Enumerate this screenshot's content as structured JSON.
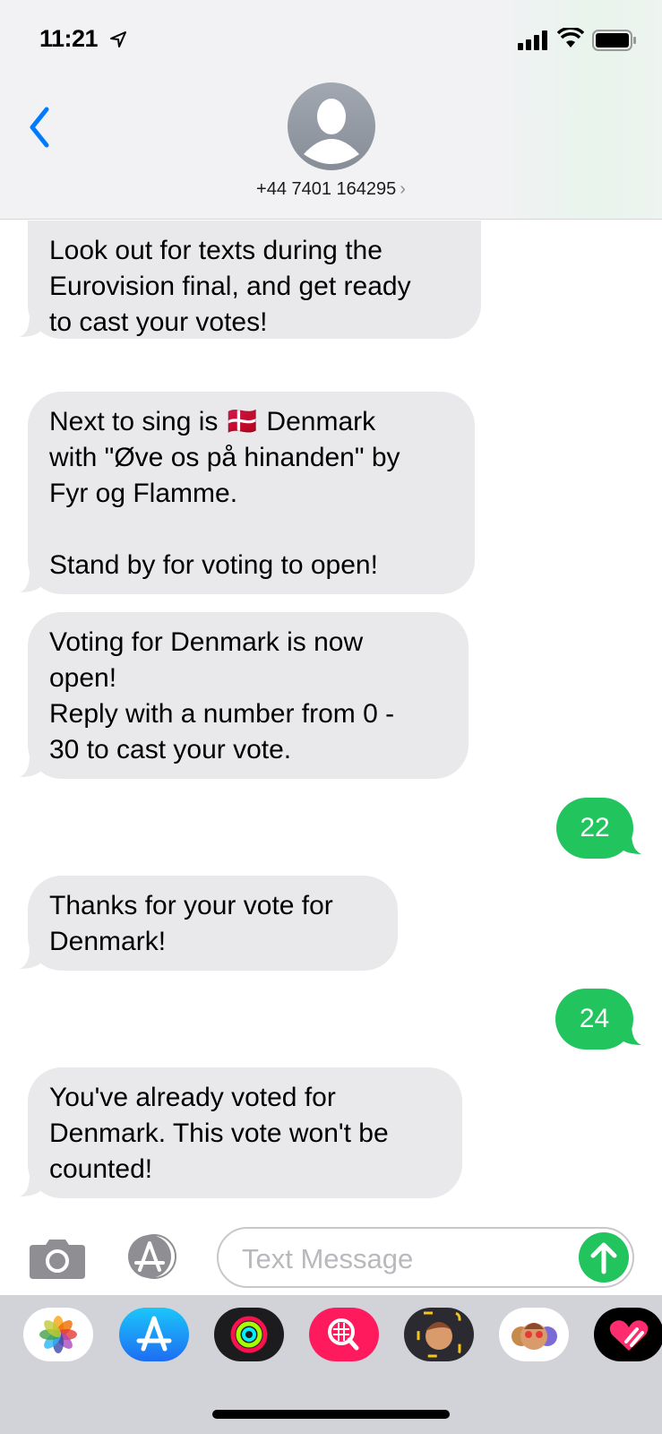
{
  "status_bar": {
    "time": "11:21",
    "icons": [
      "location-arrow-icon",
      "cellular-signal-icon",
      "wifi-icon",
      "battery-icon"
    ]
  },
  "header": {
    "back_icon": "chevron-left-icon",
    "contact": "+44 7401 164295",
    "chevron": "›",
    "avatar_icon": "person-silhouette-icon"
  },
  "messages": [
    {
      "direction": "incoming",
      "text": "Look out for texts during the\nEurovision final, and get ready\nto cast your votes!"
    },
    {
      "direction": "incoming",
      "text": "Next to sing is 🇩🇰 Denmark\nwith \"Øve os på hinanden\" by\nFyr og Flamme.\n\nStand by for voting to open!"
    },
    {
      "direction": "incoming",
      "text": "Voting for Denmark is now\nopen!\nReply with a number from 0 -\n30 to cast your vote."
    },
    {
      "direction": "outgoing",
      "text": "22"
    },
    {
      "direction": "incoming",
      "text": "Thanks for your vote for\nDenmark!"
    },
    {
      "direction": "outgoing",
      "text": "24"
    },
    {
      "direction": "incoming",
      "text": "You've already voted for\nDenmark. This vote won't be\ncounted!"
    }
  ],
  "composer": {
    "placeholder": "Text Message",
    "camera_icon": "camera-icon",
    "apps_icon": "app-store-icon",
    "send_icon": "send-arrow-up-icon"
  },
  "app_strip": [
    "photos-app-icon",
    "app-store-app-icon",
    "activity-app-icon",
    "search-images-app-icon",
    "memoji-app-icon",
    "animoji-stickers-app-icon",
    "digital-touch-app-icon"
  ],
  "colors": {
    "accent": "#007aff",
    "outgoing": "#22c45e",
    "incoming": "#e9e9eb"
  }
}
